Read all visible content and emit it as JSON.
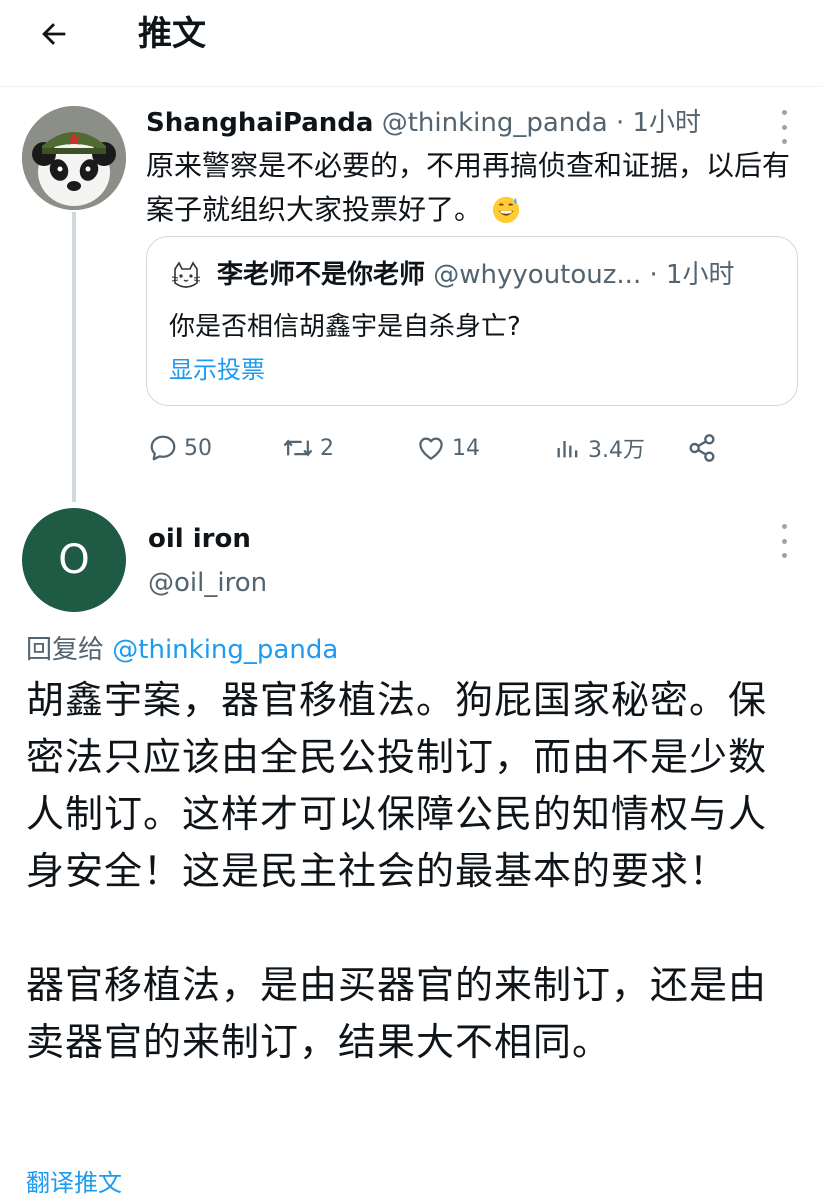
{
  "header": {
    "title": "推文"
  },
  "tweet": {
    "display_name": "ShanghaiPanda",
    "handle": "@thinking_panda",
    "time": "· 1小时",
    "text": "原来警察是不必要的，不用再搞侦查和证据，以后有案子就组织大家投票好了。",
    "emoji": "grinning-sweat-emoji",
    "quote": {
      "display_name": "李老师不是你老师",
      "handle": "@whyyoutouz...",
      "time": "· 1小时",
      "text": "你是否相信胡鑫宇是自杀身亡?",
      "link": "显示投票"
    },
    "actions": {
      "replies": "50",
      "retweets": "2",
      "likes": "14",
      "views": "3.4万"
    }
  },
  "reply": {
    "avatar_letter": "O",
    "avatar_color": "#1e5a44",
    "display_name": "oil iron",
    "handle": "@oil_iron",
    "replying_label": "回复给",
    "replying_handle": "@thinking_panda",
    "paragraph_1": "胡鑫宇案，器官移植法。狗屁国家秘密。保密法只应该由全民公投制订，而由不是少数人制订。这样才可以保障公民的知情权与人身安全！这是民主社会的最基本的要求！",
    "paragraph_2": "器官移植法，是由买器官的来制订，还是由卖器官的来制订，结果大不相同。",
    "translate": "翻译推文"
  },
  "colors": {
    "accent": "#1d9bf0",
    "muted": "#536471",
    "text": "#0f1419"
  }
}
